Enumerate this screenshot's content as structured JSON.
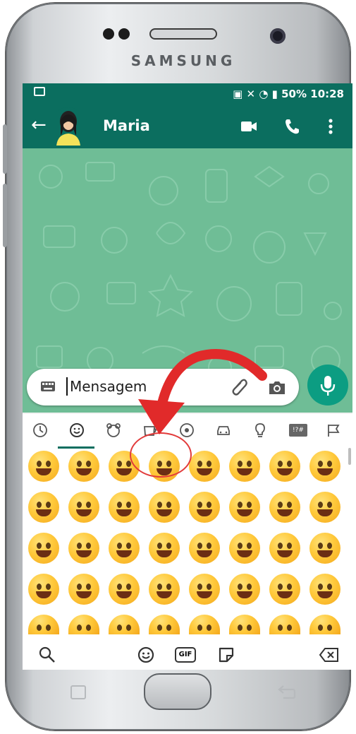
{
  "device": {
    "brand": "SAMSUNG"
  },
  "status_bar": {
    "right_text": "50% 10:28"
  },
  "app_bar": {
    "contact_name": "Maria",
    "back_glyph": "←"
  },
  "chat_input": {
    "placeholder": "Mensagem"
  },
  "keyboard": {
    "categories": [
      "recent-icon",
      "smiley-icon",
      "animal-icon",
      "food-icon",
      "sport-icon",
      "car-icon",
      "bulb-icon",
      "symbols-icon",
      "flag-icon"
    ],
    "symbols_label": "!?#",
    "emoji_rows": 5,
    "emoji_cols": 8,
    "selected_emoji": "grinning-face-with-smiling-eyes",
    "bottom": {
      "gif_label": "GIF"
    }
  },
  "colors": {
    "primary": "#0b6e5f",
    "accent": "#0c9d82",
    "chat_bg": "#6fbd96",
    "annotation": "#e23b3b"
  }
}
